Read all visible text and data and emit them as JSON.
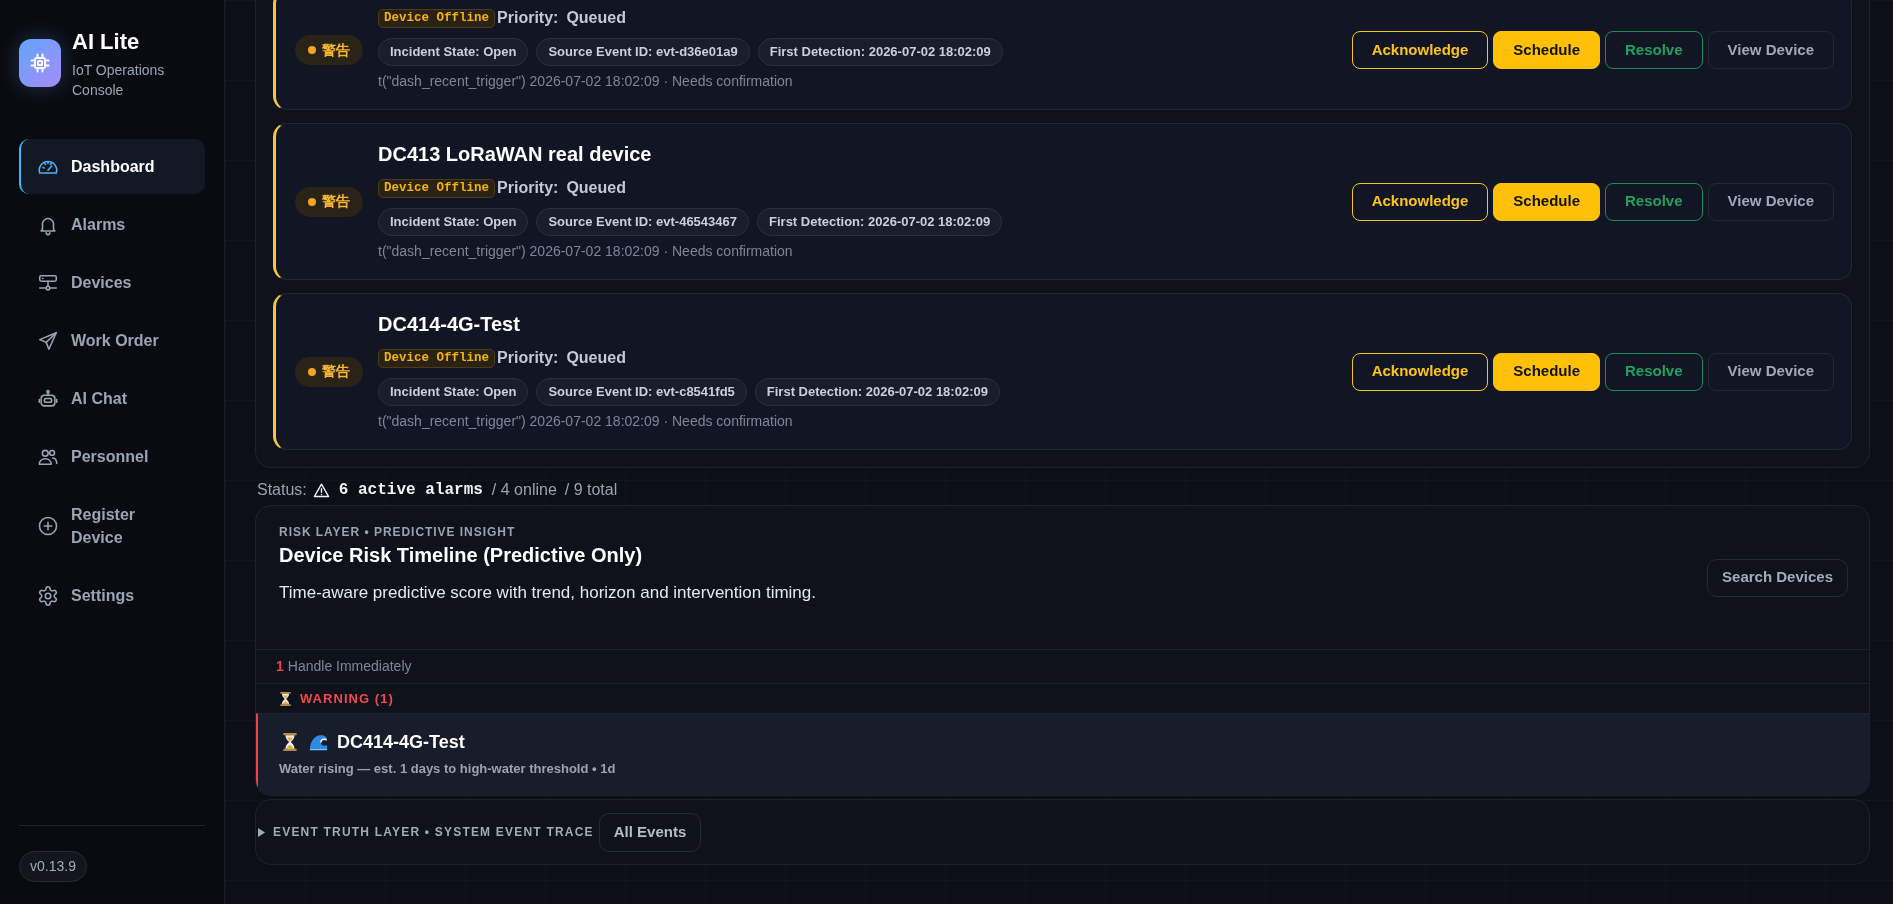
{
  "sidebar": {
    "brand": {
      "title": "AI Lite",
      "subtitle": "IoT Operations Console"
    },
    "nav": [
      {
        "label": "Dashboard",
        "selected": true
      },
      {
        "label": "Alarms",
        "selected": false
      },
      {
        "label": "Devices",
        "selected": false
      },
      {
        "label": "Work Order",
        "selected": false
      },
      {
        "label": "AI Chat",
        "selected": false
      },
      {
        "label": "Personnel",
        "selected": false
      },
      {
        "label": "Register Device",
        "selected": false
      },
      {
        "label": "Settings",
        "selected": false
      }
    ],
    "version": "v0.13.9"
  },
  "alarms": [
    {
      "severity": "警告",
      "type": "Device Offline",
      "priority_label": "Priority:",
      "priority": "Queued",
      "chips": [
        "Incident State: Open",
        "Source Event ID: evt-d36e01a9",
        "First Detection: 2026-07-02 18:02:09"
      ],
      "trigger": "t(\"dash_recent_trigger\") 2026-07-02 18:02:09 · Needs confirmation",
      "actions": [
        {
          "label": "Acknowledge",
          "kind": "outline"
        },
        {
          "label": "Schedule",
          "kind": "solid"
        },
        {
          "label": "Resolve",
          "kind": "success"
        },
        {
          "label": "View Device",
          "kind": "ghost"
        }
      ]
    },
    {
      "title": "DC413 LoRaWAN real device",
      "severity": "警告",
      "type": "Device Offline",
      "priority_label": "Priority:",
      "priority": "Queued",
      "chips": [
        "Incident State: Open",
        "Source Event ID: evt-46543467",
        "First Detection: 2026-07-02 18:02:09"
      ],
      "trigger": "t(\"dash_recent_trigger\") 2026-07-02 18:02:09 · Needs confirmation",
      "actions": [
        {
          "label": "Acknowledge",
          "kind": "outline"
        },
        {
          "label": "Schedule",
          "kind": "solid"
        },
        {
          "label": "Resolve",
          "kind": "success"
        },
        {
          "label": "View Device",
          "kind": "ghost"
        }
      ]
    },
    {
      "title": "DC414-4G-Test",
      "severity": "警告",
      "type": "Device Offline",
      "priority_label": "Priority:",
      "priority": "Queued",
      "chips": [
        "Incident State: Open",
        "Source Event ID: evt-c8541fd5",
        "First Detection: 2026-07-02 18:02:09"
      ],
      "trigger": "t(\"dash_recent_trigger\") 2026-07-02 18:02:09 · Needs confirmation",
      "actions": [
        {
          "label": "Acknowledge",
          "kind": "outline"
        },
        {
          "label": "Schedule",
          "kind": "solid"
        },
        {
          "label": "Resolve",
          "kind": "success"
        },
        {
          "label": "View Device",
          "kind": "ghost"
        }
      ]
    }
  ],
  "status": {
    "label": "Status:",
    "active_alarms": "6 active alarms",
    "online": "/ 4 online",
    "total": "/ 9 total"
  },
  "risk_panel": {
    "eyebrow": "RISK LAYER • PREDICTIVE INSIGHT",
    "title": "Device Risk Timeline (Predictive Only)",
    "description": "Time-aware predictive score with trend, horizon and intervention timing.",
    "button": "Search Devices",
    "summary": {
      "count": "1",
      "label": "Handle Immediately"
    },
    "groups": [
      {
        "label": "WARNING (1)",
        "items": [
          {
            "name": "DC414-4G-Test",
            "detail": "Water rising — est. 1 days to high-water threshold • 1d"
          }
        ]
      }
    ]
  },
  "event_panel": {
    "expanded": false,
    "label": "EVENT TRUTH LAYER • SYSTEM EVENT TRACE",
    "button": "All Events"
  }
}
